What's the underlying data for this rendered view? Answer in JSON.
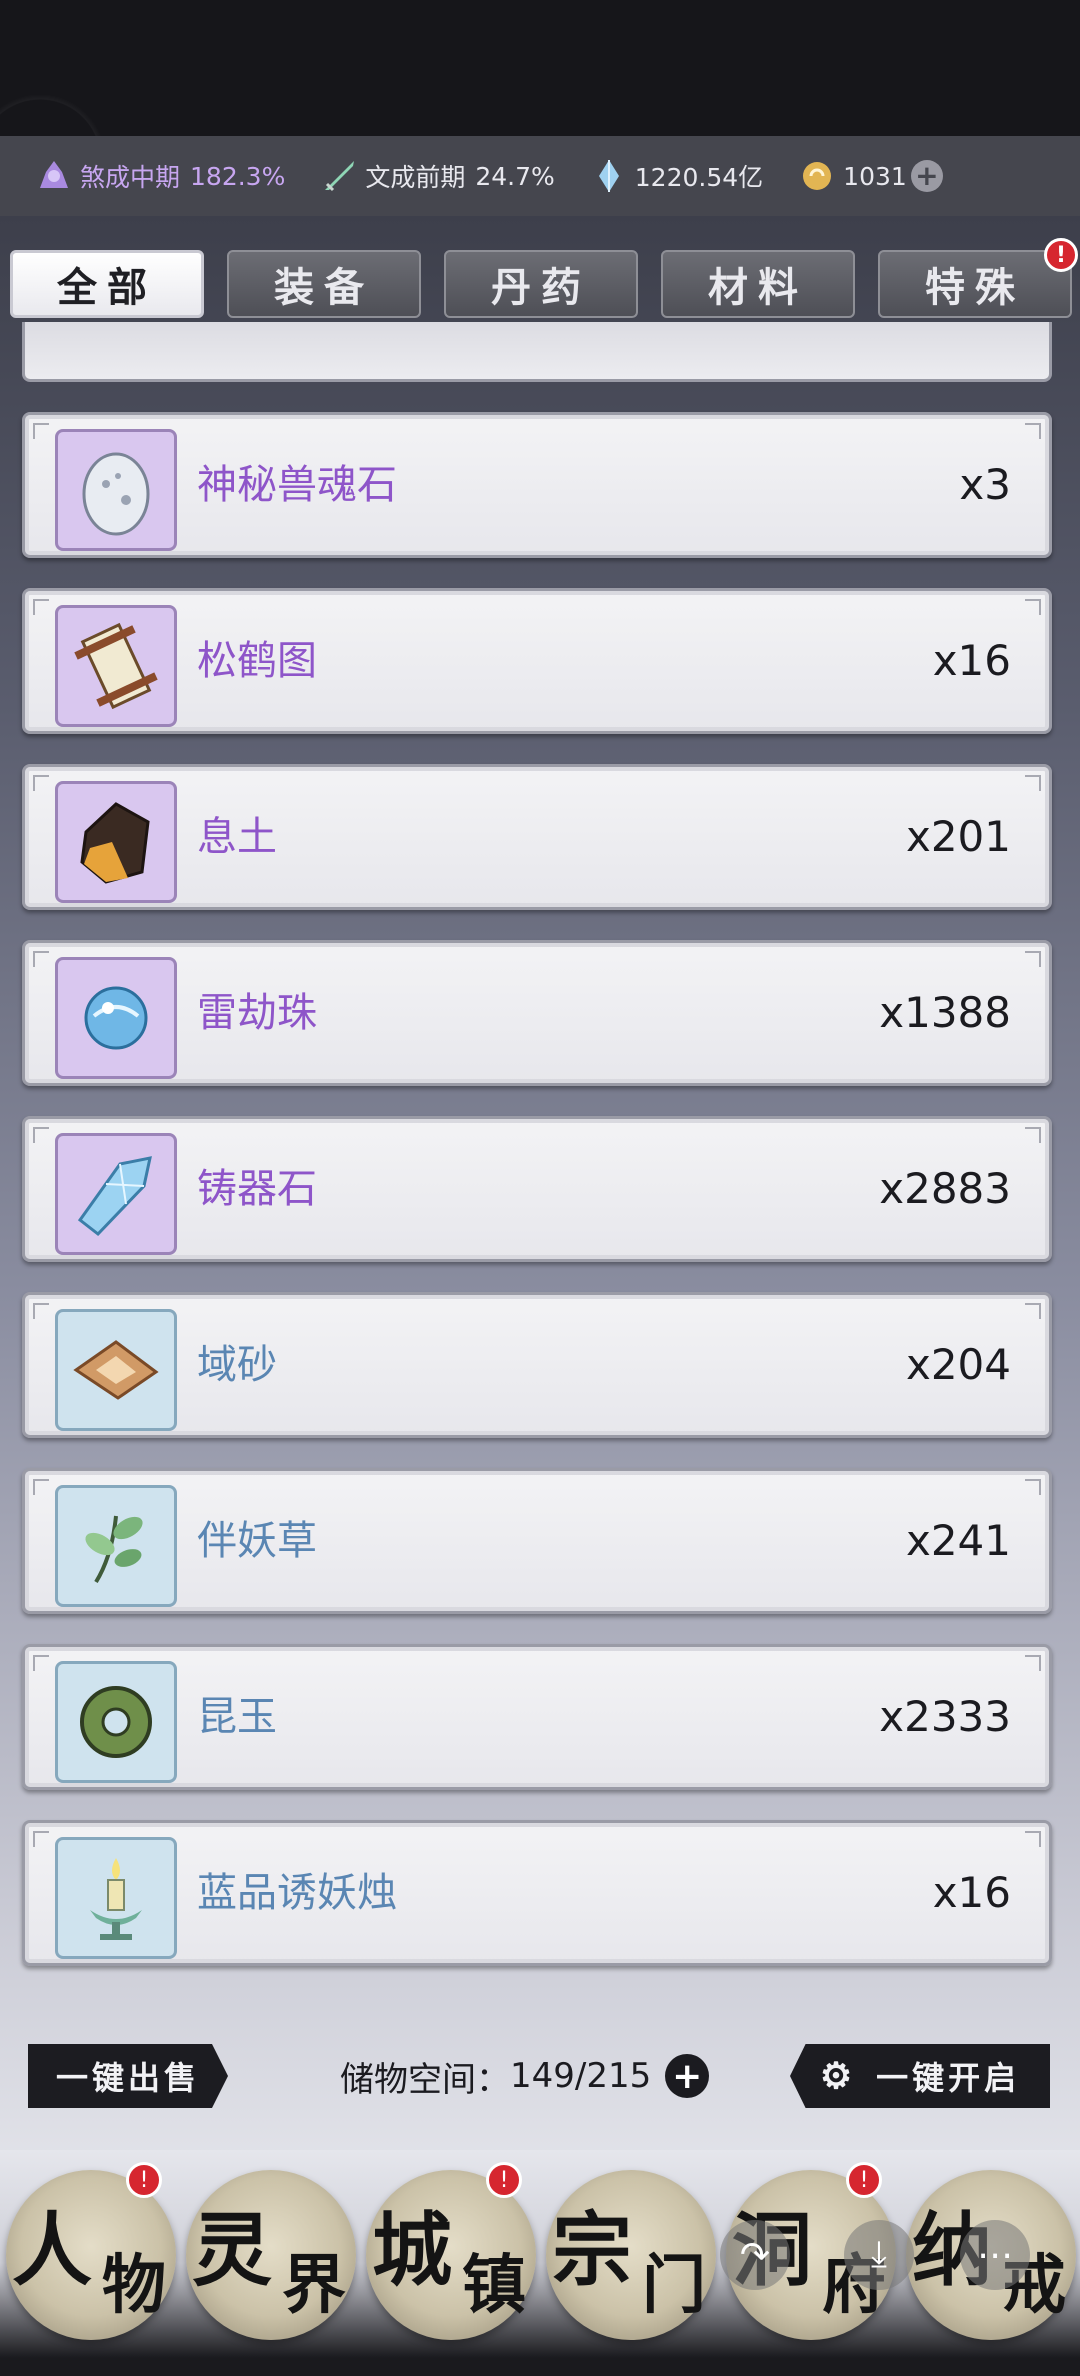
{
  "status": {
    "realm1_label": "煞成中期",
    "realm1_pct": "182.3%",
    "realm2_label": "文成前期",
    "realm2_pct": "24.7%",
    "spirit_stones": "1220.54亿",
    "gold": "1031",
    "add_label": "+"
  },
  "tabs": [
    {
      "label": "全部",
      "active": true
    },
    {
      "label": "装备",
      "active": false
    },
    {
      "label": "丹药",
      "active": false
    },
    {
      "label": "材料",
      "active": false
    },
    {
      "label": "特殊",
      "active": false,
      "badge": "!"
    }
  ],
  "items": [
    {
      "name": "神秘兽魂石",
      "qty": "x3",
      "rarity": "purple",
      "icon": "egg-icon"
    },
    {
      "name": "松鹤图",
      "qty": "x16",
      "rarity": "purple",
      "icon": "scroll-icon"
    },
    {
      "name": "息土",
      "qty": "x201",
      "rarity": "purple",
      "icon": "soil-icon"
    },
    {
      "name": "雷劫珠",
      "qty": "x1388",
      "rarity": "purple",
      "icon": "orb-icon"
    },
    {
      "name": "铸器石",
      "qty": "x2883",
      "rarity": "purple",
      "icon": "crystal-icon"
    },
    {
      "name": "域砂",
      "qty": "x204",
      "rarity": "blue",
      "icon": "sand-icon"
    },
    {
      "name": "伴妖草",
      "qty": "x241",
      "rarity": "blue",
      "icon": "herb-icon"
    },
    {
      "name": "昆玉",
      "qty": "x2333",
      "rarity": "blue",
      "icon": "jade-ring-icon"
    },
    {
      "name": "蓝品诱妖烛",
      "qty": "x16",
      "rarity": "blue",
      "icon": "candle-icon"
    }
  ],
  "bottom": {
    "sell_all": "一键出售",
    "storage_label": "储物空间：",
    "storage_value": "149/215",
    "open_all": "一键开启"
  },
  "nav": [
    {
      "t1": "人",
      "t2": "物",
      "badge": "!"
    },
    {
      "t1": "灵",
      "t2": "界",
      "badge": ""
    },
    {
      "t1": "城",
      "t2": "镇",
      "badge": "!"
    },
    {
      "t1": "宗",
      "t2": "门",
      "badge": ""
    },
    {
      "t1": "洞",
      "t2": "府",
      "badge": "!"
    },
    {
      "t1": "纳",
      "t2": "戒",
      "badge": ""
    }
  ],
  "colors": {
    "purple_text": "#8e55c9",
    "blue_text": "#5a86b3",
    "badge_red": "#d6262f"
  }
}
